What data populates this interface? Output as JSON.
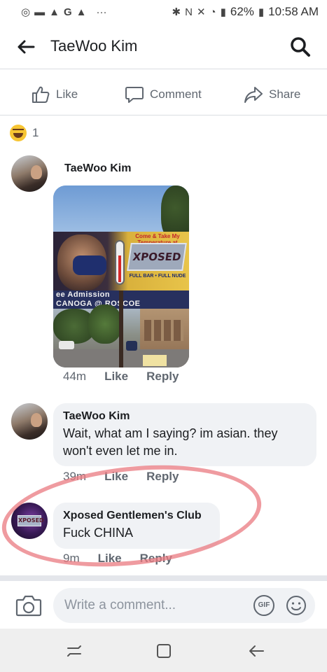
{
  "status_bar": {
    "battery": "62%",
    "time": "10:58 AM",
    "left_icons": [
      "whatsapp-icon",
      "message-icon",
      "gallery-icon",
      "google-icon",
      "gallery-icon"
    ],
    "right_icons": [
      "bluetooth-icon",
      "nfc-icon",
      "mute-icon",
      "wifi-icon",
      "signal-icon",
      "battery-icon"
    ]
  },
  "header": {
    "title": "TaeWoo Kim",
    "back_icon": "back-arrow-icon",
    "search_icon": "search-icon"
  },
  "post_actions": {
    "like_label": "Like",
    "comment_label": "Comment",
    "share_label": "Share"
  },
  "reactions": {
    "type": "haha",
    "count": "1"
  },
  "comments": [
    {
      "author": "TaeWoo Kim",
      "text": "",
      "has_photo": true,
      "photo": {
        "billboard_top": "Come & Take My Temperature at",
        "billboard_logo": "XPOSED",
        "billboard_strip": "FULL BAR • FULL NUDE",
        "street_line1": "ee Admission",
        "street_line2": "CANOGA @ ROSCOE"
      },
      "time": "44m",
      "like": "Like",
      "reply": "Reply"
    },
    {
      "author": "TaeWoo Kim",
      "text": "Wait, what am I saying? im asian. they won't even let me in.",
      "time": "39m",
      "like": "Like",
      "reply": "Reply"
    },
    {
      "author": "Xposed Gentlemen's Club",
      "text": "Fuck CHINA",
      "time": "9m",
      "like": "Like",
      "reply": "Reply"
    }
  ],
  "composer": {
    "placeholder": "Write a comment...",
    "gif_label": "GIF"
  },
  "colors": {
    "meta_gray": "#606770",
    "bubble_bg": "#f0f2f5",
    "highlight_ring": "#e97a80"
  }
}
